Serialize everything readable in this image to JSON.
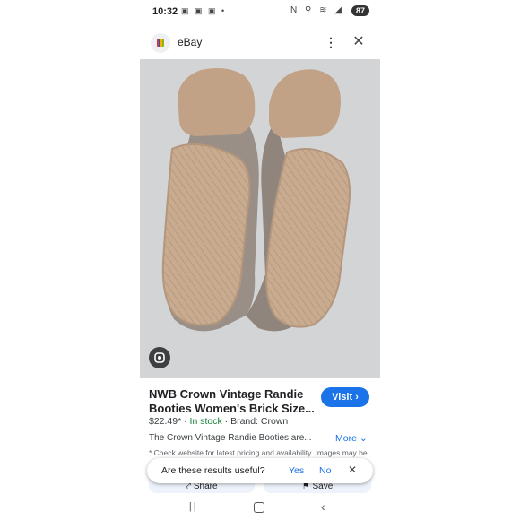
{
  "status": {
    "time": "10:32",
    "battery": "87"
  },
  "app": {
    "title": "eBay"
  },
  "product": {
    "title": "NWB Crown Vintage Randie Booties Women's Brick Size...",
    "price": "$22.49*",
    "stock": "In stock",
    "brand": "Brand: Crown",
    "description": "The Crown Vintage Randie Booties are...",
    "more_label": "More",
    "notice": "* Check website for latest pricing and availability. Images may be subject to copyright."
  },
  "actions": {
    "visit_label": "Visit",
    "share_label": "Share",
    "save_label": "Save"
  },
  "feedback": {
    "question": "Are these results useful?",
    "yes": "Yes",
    "no": "No"
  },
  "colors": {
    "accent": "#1a73e8",
    "in_stock": "#188038",
    "sole": "#c8aa8e"
  },
  "icons": {
    "more": "more-vert-icon",
    "close": "close-icon",
    "lens": "lens-icon",
    "share": "share-icon",
    "save": "bookmark-icon"
  }
}
